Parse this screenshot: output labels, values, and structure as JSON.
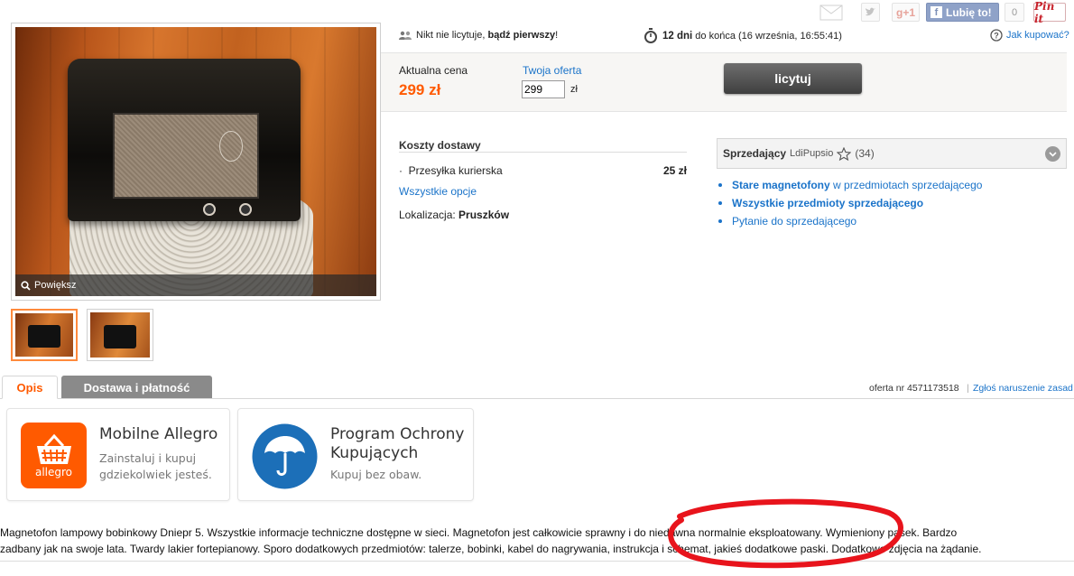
{
  "social": {
    "gplus": "g+1",
    "like_label": "Lubię to!",
    "like_count": "0",
    "pinit": "Pin it"
  },
  "gallery": {
    "zoom_label": "Powiększ"
  },
  "auction": {
    "bidders_prefix": "Nikt nie licytuje, ",
    "bidders_strong": "bądź pierwszy",
    "bidders_suffix": "!",
    "time_strong": "12 dni",
    "time_rest": " do końca (16 września, 16:55:41)",
    "how_to_buy": "Jak kupować?"
  },
  "price": {
    "label": "Aktualna cena",
    "value": "299 zł",
    "offer_label": "Twoja oferta",
    "offer_value": "299",
    "currency": "zł",
    "bid_button": "licytuj"
  },
  "shipping": {
    "title": "Koszty dostawy",
    "method": "Przesyłka kurierska",
    "cost": "25 zł",
    "all_options": "Wszystkie opcje",
    "location_label": "Lokalizacja: ",
    "location_value": "Pruszków"
  },
  "seller": {
    "label": "Sprzedający",
    "name": "LdiPupsio",
    "rating": "(34)",
    "links": [
      {
        "strong": "Stare magnetofony",
        "rest": " w przedmiotach sprzedającego"
      },
      {
        "strong": "Wszystkie przedmioty sprzedającego",
        "rest": ""
      },
      {
        "strong": "",
        "rest": "Pytanie do sprzedającego"
      }
    ]
  },
  "tabs": {
    "description": "Opis",
    "delivery": "Dostawa i płatność"
  },
  "offer": {
    "number": "oferta nr 4571173518",
    "separator": "|",
    "report": "Zgłoś naruszenie zasad"
  },
  "promos": {
    "mobile": {
      "title": "Mobilne Allegro",
      "line1": "Zainstaluj i kupuj",
      "line2": "gdziekolwiek jesteś.",
      "logo_text": "allegro"
    },
    "protection": {
      "title1": "Program Ochrony",
      "title2": "Kupujących",
      "sub": "Kupuj bez obaw."
    }
  },
  "description": {
    "line1": "Magnetofon lampowy bobinkowy Dniepr 5. Wszystkie informacje techniczne dostępne w sieci. Magnetofon jest całkowicie sprawny i do niedawna normalnie eksploatowany. Wymieniony pasek. Bardzo",
    "line2": "zadbany jak na swoje lata. Twardy lakier fortepianowy. Sporo dodatkowych przedmiotów: talerze, bobinki, kabel do nagrywania, instrukcja i schemat, jakieś dodatkowe paski. Dodatkowe zdjęcia na żądanie."
  },
  "colors": {
    "price": "#ff5a00",
    "link": "#1a73c9",
    "annotation": "#e8141c",
    "allegro_orange": "#ff5a00",
    "protection_blue": "#1c6fb8"
  }
}
